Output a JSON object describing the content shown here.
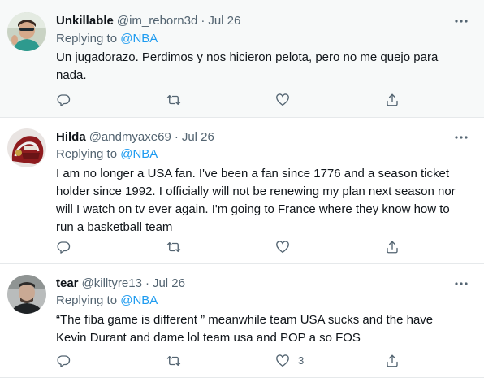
{
  "tweets": [
    {
      "name": "Unkillable",
      "handle": "@im_reborn3d",
      "separator": "·",
      "date": "Jul 26",
      "replying_prefix": "Replying to ",
      "replying_mention": "@NBA",
      "text": "Un jugadorazo. Perdimos y nos hicieron pelota, pero no me quejo para nada.",
      "counts": {
        "reply": "",
        "retweet": "",
        "like": "",
        "share": ""
      },
      "avatar_icon": "user-avatar"
    },
    {
      "name": "Hilda",
      "handle": "@andmyaxe69",
      "separator": "·",
      "date": "Jul 26",
      "replying_prefix": "Replying to ",
      "replying_mention": "@NBA",
      "text": "I am no longer a USA fan. I've been a fan since 1776 and a season ticket holder since 1992. I officially will not be renewing my plan next season nor will I watch on tv ever again. I'm going to France where they know how to run a basketball team",
      "counts": {
        "reply": "",
        "retweet": "",
        "like": "",
        "share": ""
      },
      "avatar_icon": "user-avatar"
    },
    {
      "name": "tear",
      "handle": "@killtyre13",
      "separator": "·",
      "date": "Jul 26",
      "replying_prefix": "Replying to ",
      "replying_mention": "@NBA",
      "text": "“The fiba game is different ” meanwhile team USA sucks and the have Kevin Durant and dame lol team usa and POP a so FOS",
      "counts": {
        "reply": "",
        "retweet": "",
        "like": "3",
        "share": ""
      },
      "avatar_icon": "user-avatar"
    }
  ],
  "icons": {
    "more": "more-dots-icon",
    "reply": "reply-bubble-icon",
    "retweet": "retweet-arrows-icon",
    "like": "heart-icon",
    "share": "share-upload-icon"
  },
  "colors": {
    "text": "#0f1419",
    "muted": "#536471",
    "link": "#1d9bf0",
    "divider": "#e6e9eb",
    "highlight_bg": "#f7f9f9"
  }
}
